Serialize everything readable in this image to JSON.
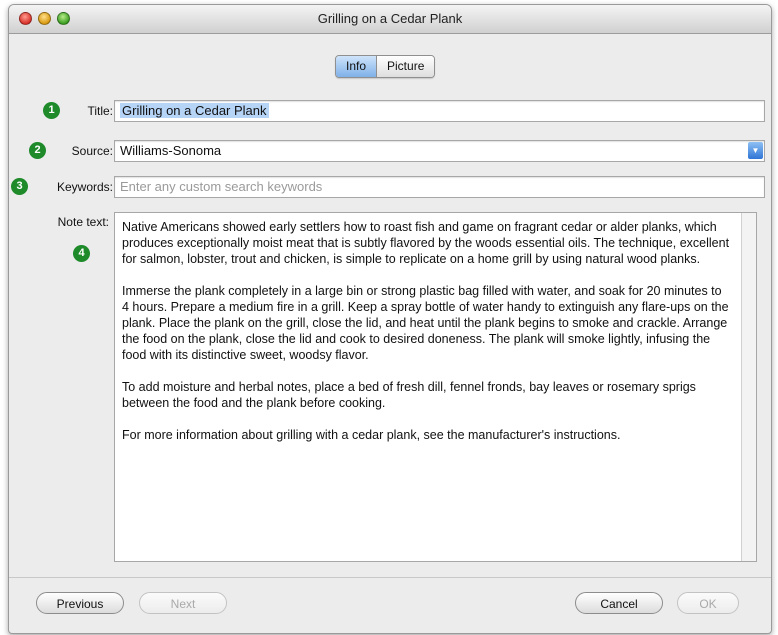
{
  "window": {
    "title": "Grilling on a Cedar Plank"
  },
  "tabs": [
    {
      "label": "Info",
      "active": true
    },
    {
      "label": "Picture",
      "active": false
    }
  ],
  "fields": {
    "title": {
      "label": "Title:",
      "value": "Grilling on a Cedar Plank",
      "badge": "1"
    },
    "source": {
      "label": "Source:",
      "value": "Williams-Sonoma",
      "badge": "2"
    },
    "keywords": {
      "label": "Keywords:",
      "value": "",
      "placeholder": "Enter any custom search keywords",
      "badge": "3"
    },
    "note": {
      "label": "Note text:",
      "badge": "4",
      "paragraphs": [
        "Native Americans showed early settlers how to roast fish and game on fragrant cedar or alder planks, which produces exceptionally moist meat that is subtly flavored by the woods essential oils. The technique, excellent for salmon, lobster, trout and chicken, is simple to replicate on a home grill by using natural wood planks.",
        "Immerse the plank completely in a large bin or strong plastic bag filled with water, and soak for 20 minutes to 4 hours. Prepare a medium fire in a grill. Keep a spray bottle of water handy to extinguish any flare-ups on the plank. Place the plank on the grill, close the lid, and heat until the plank begins to smoke and crackle. Arrange the food on the plank, close the lid and cook to desired doneness. The plank will smoke lightly, infusing the food with its distinctive sweet, woodsy flavor.",
        "To add moisture and herbal notes, place a bed of fresh dill, fennel fronds, bay leaves or rosemary sprigs between the food and the plank before cooking.",
        "For more information about grilling with a cedar plank, see the manufacturer's instructions."
      ]
    }
  },
  "buttons": {
    "previous": "Previous",
    "next": "Next",
    "cancel": "Cancel",
    "ok": "OK"
  }
}
